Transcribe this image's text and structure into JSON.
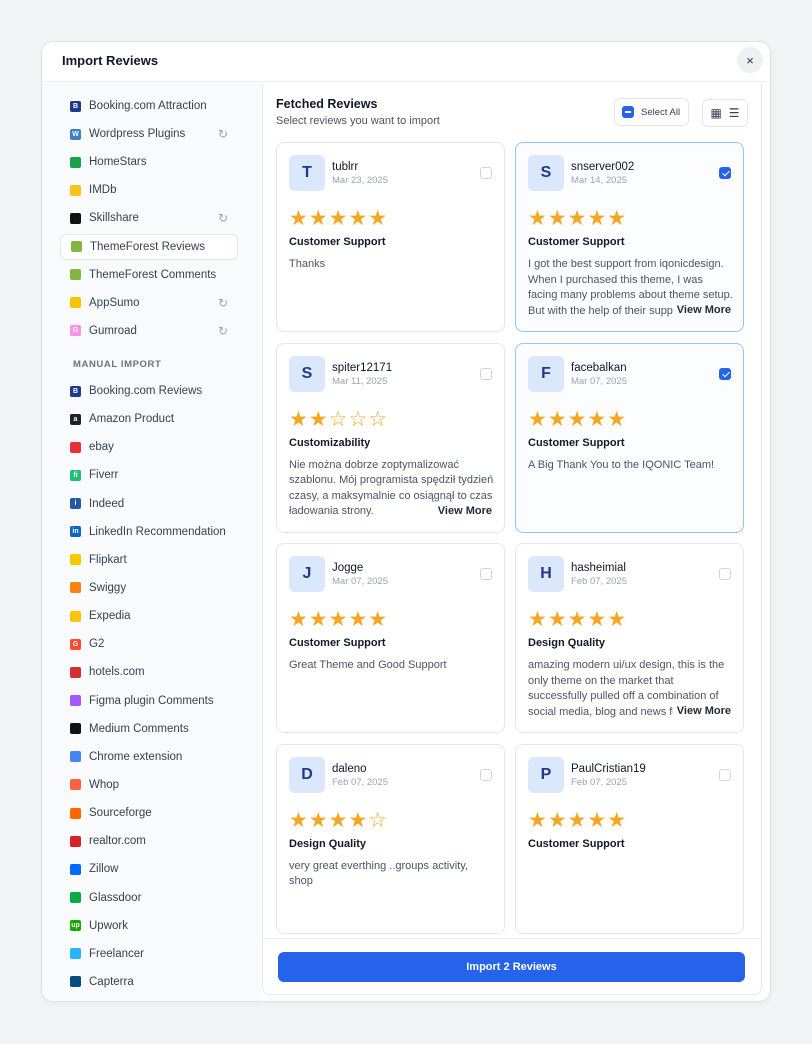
{
  "modal": {
    "title": "Import Reviews",
    "close_label": "×"
  },
  "sidebar": {
    "platforms": [
      {
        "label": "Booking.com Attraction",
        "icon": "booking-icon",
        "color": "#1f3a8a",
        "glyph": "B",
        "sync": false
      },
      {
        "label": "Wordpress Plugins",
        "icon": "wordpress-icon",
        "color": "#3b82c4",
        "glyph": "W",
        "sync": true
      },
      {
        "label": "HomeStars",
        "icon": "homestars-icon",
        "color": "#16a34a",
        "glyph": "",
        "sync": false
      },
      {
        "label": "IMDb",
        "icon": "imdb-icon",
        "color": "#f5c518",
        "glyph": "",
        "sync": false
      },
      {
        "label": "Skillshare",
        "icon": "skillshare-icon",
        "color": "#111111",
        "glyph": "",
        "sync": true
      },
      {
        "label": "ThemeForest Reviews",
        "icon": "themeforest-icon",
        "color": "#82b541",
        "glyph": "",
        "sync": false,
        "active": true
      },
      {
        "label": "ThemeForest Comments",
        "icon": "themeforest-icon",
        "color": "#82b541",
        "glyph": "",
        "sync": false
      },
      {
        "label": "AppSumo",
        "icon": "appsumo-icon",
        "color": "#f7c600",
        "glyph": "",
        "sync": true
      },
      {
        "label": "Gumroad",
        "icon": "gumroad-icon",
        "color": "#ff90e8",
        "glyph": "G",
        "sync": true
      }
    ],
    "manual_section_label": "MANUAL IMPORT",
    "manual": [
      {
        "label": "Booking.com Reviews",
        "icon": "booking-icon",
        "color": "#1f3a8a",
        "glyph": "B"
      },
      {
        "label": "Amazon Product",
        "icon": "amazon-icon",
        "color": "#222222",
        "glyph": "a"
      },
      {
        "label": "ebay",
        "icon": "ebay-icon",
        "color": "#e53238",
        "glyph": ""
      },
      {
        "label": "Fiverr",
        "icon": "fiverr-icon",
        "color": "#1dbf73",
        "glyph": "fi"
      },
      {
        "label": "Indeed",
        "icon": "indeed-icon",
        "color": "#2557a7",
        "glyph": "i"
      },
      {
        "label": "LinkedIn Recommendation",
        "icon": "linkedin-icon",
        "color": "#0a66c2",
        "glyph": "in"
      },
      {
        "label": "Flipkart",
        "icon": "flipkart-icon",
        "color": "#f8c900",
        "glyph": ""
      },
      {
        "label": "Swiggy",
        "icon": "swiggy-icon",
        "color": "#fc8019",
        "glyph": ""
      },
      {
        "label": "Expedia",
        "icon": "expedia-icon",
        "color": "#fcc40f",
        "glyph": ""
      },
      {
        "label": "G2",
        "icon": "g2-icon",
        "color": "#ff492c",
        "glyph": "G"
      },
      {
        "label": "hotels.com",
        "icon": "hotels-icon",
        "color": "#d32f2f",
        "glyph": ""
      },
      {
        "label": "Figma plugin Comments",
        "icon": "figma-icon",
        "color": "#a259ff",
        "glyph": ""
      },
      {
        "label": "Medium Comments",
        "icon": "medium-icon",
        "color": "#111111",
        "glyph": ""
      },
      {
        "label": "Chrome extension",
        "icon": "chrome-icon",
        "color": "#4285f4",
        "glyph": ""
      },
      {
        "label": "Whop",
        "icon": "whop-icon",
        "color": "#ff6243",
        "glyph": ""
      },
      {
        "label": "Sourceforge",
        "icon": "sourceforge-icon",
        "color": "#ff6600",
        "glyph": ""
      },
      {
        "label": "realtor.com",
        "icon": "realtor-icon",
        "color": "#d92228",
        "glyph": ""
      },
      {
        "label": "Zillow",
        "icon": "zillow-icon",
        "color": "#006aff",
        "glyph": ""
      },
      {
        "label": "Glassdoor",
        "icon": "glassdoor-icon",
        "color": "#0caa41",
        "glyph": ""
      },
      {
        "label": "Upwork",
        "icon": "upwork-icon",
        "color": "#14a800",
        "glyph": "up"
      },
      {
        "label": "Freelancer",
        "icon": "freelancer-icon",
        "color": "#29b2fe",
        "glyph": ""
      },
      {
        "label": "Capterra",
        "icon": "capterra-icon",
        "color": "#044d80",
        "glyph": ""
      }
    ]
  },
  "main": {
    "title": "Fetched Reviews",
    "subtitle": "Select reviews you want to import",
    "select_all_label": "Select All",
    "view_toggle": {
      "grid_icon": "grid-view-icon",
      "list_icon": "list-view-icon"
    },
    "reviews": [
      {
        "initial": "T",
        "name": "tublrr",
        "date": "Mar 23, 2025",
        "rating": 5,
        "category": "Customer Support",
        "text": "Thanks",
        "view_more": "",
        "checked": false
      },
      {
        "initial": "S",
        "name": "snserver002",
        "date": "Mar 14, 2025",
        "rating": 5,
        "category": "Customer Support",
        "text": "I got the best support from iqonicdesign. When I purchased this theme, I was facing many problems about theme setup. But with the help of their support team everything was solved.",
        "view_more": "View More",
        "checked": true
      },
      {
        "initial": "S",
        "name": "spiter12171",
        "date": "Mar 11, 2025",
        "rating": 2,
        "category": "Customizability",
        "text": "Nie można dobrze zoptymalizować szablonu. Mój programista spędził tydzień czasy, a maksymalnie co osiągnął to czas ładowania strony.",
        "view_more": "View More",
        "checked": false
      },
      {
        "initial": "F",
        "name": "facebalkan",
        "date": "Mar 07, 2025",
        "rating": 5,
        "category": "Customer Support",
        "text": "A Big Thank You to the IQONIC Team!",
        "view_more": "",
        "checked": true
      },
      {
        "initial": "J",
        "name": "Jogge",
        "date": "Mar 07, 2025",
        "rating": 5,
        "category": "Customer Support",
        "text": "Great Theme and Good Support",
        "view_more": "",
        "checked": false
      },
      {
        "initial": "H",
        "name": "hasheimial",
        "date": "Feb 07, 2025",
        "rating": 5,
        "category": "Design Quality",
        "text": "amazing modern ui/ux design, this is the only theme on the market that successfully pulled off a combination of social media, blog and news features.",
        "view_more": "View More",
        "checked": false
      },
      {
        "initial": "D",
        "name": "daleno",
        "date": "Feb 07, 2025",
        "rating": 4,
        "category": "Design Quality",
        "text": "very great everthing ..groups activity, shop",
        "view_more": "",
        "checked": false
      },
      {
        "initial": "P",
        "name": "PaulCristian19",
        "date": "Feb 07, 2025",
        "rating": 5,
        "category": "Customer Support",
        "text": "",
        "view_more": "",
        "checked": false
      }
    ],
    "import_button_label": "Import 2 Reviews"
  },
  "colors": {
    "accent": "#2563eb",
    "star": "#f5a623",
    "avatar_bg": "#dbe7fb"
  }
}
